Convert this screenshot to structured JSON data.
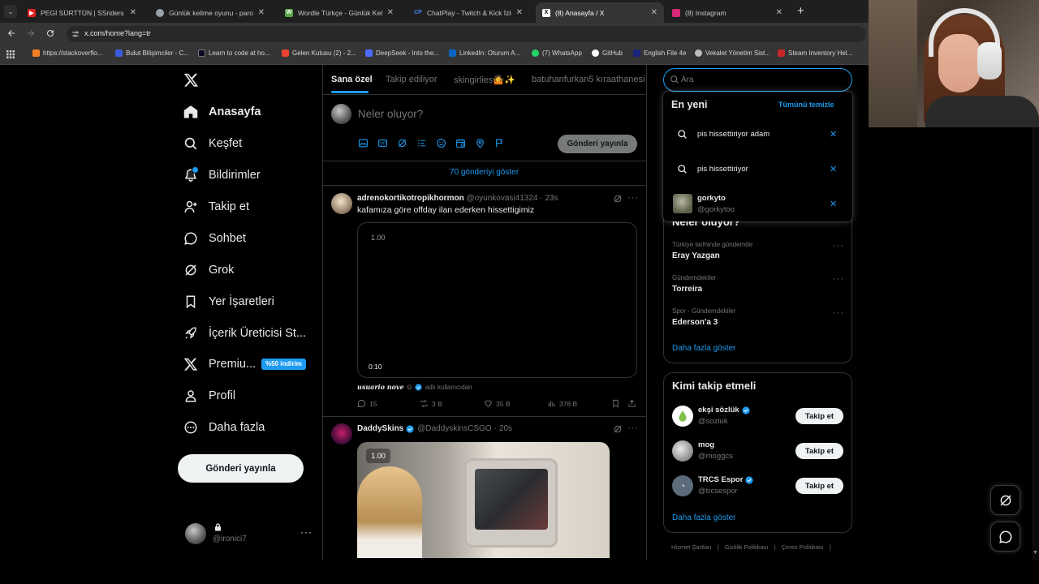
{
  "browser": {
    "tabs": [
      {
        "title": "PEGİ SÜRTTÜN | SSriders | Moto",
        "fav_color": "#e02020"
      },
      {
        "title": "Günlük kelime oyunu - parolla",
        "fav_color": "#9aa0a6"
      },
      {
        "title": "Wordle Türkçe - Günlük Kelime",
        "fav_color": "#5aa348"
      },
      {
        "title": "ChatPlay - Twitch & Kick İzleyici",
        "fav_color": "#3b82f6"
      },
      {
        "title": "(8) Anasayfa / X",
        "fav_color": "#000000"
      },
      {
        "title": "(8) Instagram",
        "fav_color": "#d62976"
      }
    ],
    "url": "x.com/home?lang=tr",
    "bookmarks": [
      {
        "label": "https://stackoverflo...",
        "color": "#f48024"
      },
      {
        "label": "Bulut Bilişimciler - C...",
        "color": "#3b5bdb"
      },
      {
        "label": "Learn to code at ho...",
        "color": "#0a0a23"
      },
      {
        "label": "Gelen Kutusu (2) - 2...",
        "color": "#ea4335"
      },
      {
        "label": "DeepSeek - Into the...",
        "color": "#4d6bfe"
      },
      {
        "label": "LinkedIn: Oturum A...",
        "color": "#0a66c2"
      },
      {
        "label": "(7) WhatsApp",
        "color": "#25d366"
      },
      {
        "label": "GitHub",
        "color": "#ffffff"
      },
      {
        "label": "English File 4e",
        "color": "#1a237e"
      },
      {
        "label": "Vekalet Yönetim Sist...",
        "color": "#bdbdbd"
      },
      {
        "label": "Steam Inventory Hel...",
        "color": "#c62828"
      }
    ]
  },
  "nav": {
    "items": [
      {
        "label": "Anasayfa",
        "icon": "home-icon"
      },
      {
        "label": "Keşfet",
        "icon": "search-icon"
      },
      {
        "label": "Bildirimler",
        "icon": "bell-icon"
      },
      {
        "label": "Takip et",
        "icon": "person-add-icon"
      },
      {
        "label": "Sohbet",
        "icon": "chat-icon"
      },
      {
        "label": "Grok",
        "icon": "grok-icon"
      },
      {
        "label": "Yer İşaretleri",
        "icon": "bookmark-icon"
      },
      {
        "label": "İçerik Üreticisi St...",
        "icon": "rocket-icon"
      },
      {
        "label": "Premiu...",
        "icon": "x-icon"
      },
      {
        "label": "Profil",
        "icon": "person-icon"
      },
      {
        "label": "Daha fazla",
        "icon": "more-circle-icon"
      }
    ],
    "premium_badge": "%50 indirim",
    "post_button": "Gönderi yayınla",
    "account_handle": "@ironici7"
  },
  "timeline": {
    "tabs": [
      "Sana özel",
      "Takip ediliyor",
      "skingirlies🤷✨",
      "batuhanfurkan5 kıraathanesi"
    ],
    "composer_placeholder": "Neler oluyor?",
    "composer_button": "Gönderi yayınla",
    "show_more": "70 gönderiyi göster",
    "posts": [
      {
        "name": "adrenokortikotropikhormon",
        "handle": "@oyunkovasi41324",
        "time": "23s",
        "text": "kafamıza göre offday ilan ederken hissettigimiz",
        "video_speed": "1.00",
        "video_time": "0:10",
        "attribution_name": "usuario nove",
        "attribution_text": "adlı kullanıcıdan",
        "replies": "15",
        "reposts": "3 B",
        "likes": "35 B",
        "views": "378 B"
      },
      {
        "name": "DaddySkins",
        "handle": "@DaddyskinsCSGO",
        "time": "20s",
        "video_speed": "1.00"
      }
    ]
  },
  "search": {
    "placeholder": "Ara",
    "dropdown_title": "En yeni",
    "clear_all": "Tümünü temizle",
    "recent": [
      {
        "type": "query",
        "text": "pis hissettiriyor adam"
      },
      {
        "type": "query",
        "text": "pis hissettiriyor"
      },
      {
        "type": "user",
        "name": "gorkyto",
        "handle": "@gorkytoo"
      }
    ]
  },
  "trends": {
    "partial_title": "Neler oluyor?",
    "items": [
      {
        "context": "Türkiye tarihinde gündemde",
        "name": "Eray Yazgan"
      },
      {
        "context": "Gündemdekiler",
        "name": "Torreira"
      },
      {
        "context": "Spor · Gündemdekiler",
        "name": "Ederson'a 3"
      }
    ],
    "show_more": "Daha fazla göster"
  },
  "who_to_follow": {
    "title": "Kimi takip etmeli",
    "accounts": [
      {
        "name": "ekşi sözlük",
        "handle": "@sozluk",
        "verified": true,
        "avatar_color": "#81c04a"
      },
      {
        "name": "mog",
        "handle": "@moggcs",
        "verified": false,
        "avatar_color": "#bfbfbf"
      },
      {
        "name": "TRCS Espor",
        "handle": "@trcsespor",
        "verified": true,
        "avatar_color": "#5b6b7a"
      }
    ],
    "follow_label": "Takip et",
    "show_more": "Daha fazla göster"
  },
  "footer": {
    "links": [
      "Hizmet Şartları",
      "Gizlilik Politikası",
      "Çerez Politikası"
    ]
  },
  "colors": {
    "accent": "#1d9bf0",
    "text": "#e7e9ea",
    "muted": "#71767b",
    "border": "#2f3336"
  }
}
